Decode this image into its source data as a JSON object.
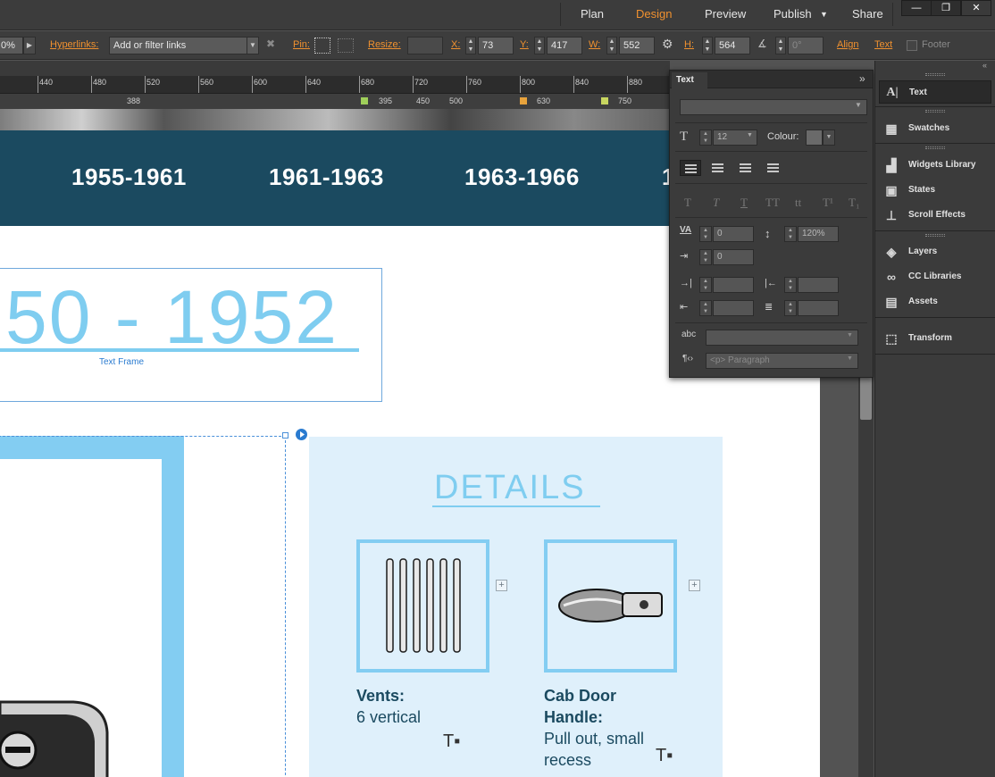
{
  "topbar": {
    "modes": [
      "Plan",
      "Design",
      "Preview",
      "Publish",
      "Share"
    ],
    "active_mode": "Design",
    "publish_arrow": "▼",
    "window_buttons": [
      "—",
      "❐",
      "✕"
    ]
  },
  "control_bar": {
    "zoom_value": "0%",
    "hyperlinks_label": "Hyperlinks:",
    "hyperlinks_placeholder": "Add or filter links",
    "pin_label": "Pin:",
    "resize_label": "Resize:",
    "x_label": "X:",
    "x_value": "73",
    "y_label": "Y:",
    "y_value": "417",
    "w_label": "W:",
    "w_value": "552",
    "h_label": "H:",
    "h_value": "564",
    "rotation_value": "0°",
    "align_label": "Align",
    "text_label": "Text",
    "footer_label": "Footer"
  },
  "ruler": {
    "ticks": [
      "440",
      "480",
      "520",
      "560",
      "600",
      "640",
      "680",
      "720",
      "760",
      "800",
      "840",
      "880"
    ],
    "sub_values": [
      "388",
      "395",
      "450",
      "500",
      "630",
      "750"
    ]
  },
  "page": {
    "nav_items": [
      "1955-1961",
      "1961-1963",
      "1963-1966",
      "1"
    ],
    "big_year": "50 - 1952",
    "text_frame_label": "Text Frame",
    "details_title": "DETAILS",
    "details": [
      {
        "label": "Vents:",
        "value": "6 vertical"
      },
      {
        "label_line1": "Cab Door",
        "label_line2": "Handle:",
        "value_line1": "Pull out, small",
        "value_line2": "recess"
      }
    ]
  },
  "text_panel": {
    "tab": "Text",
    "collapse": "»",
    "font_size": "12",
    "colour_label": "Colour:",
    "tracking": "0",
    "leading": "120%",
    "indent": "0",
    "paragraph_style": "<p> Paragraph",
    "text_style_buttons": [
      "T",
      "T",
      "T",
      "TT",
      "tt",
      "T¹",
      "T₁"
    ]
  },
  "dock": {
    "items": [
      "Text",
      "Swatches",
      "Widgets Library",
      "States",
      "Scroll Effects",
      "Layers",
      "CC Libraries",
      "Assets",
      "Transform"
    ]
  },
  "colors": {
    "accent_orange": "#f0912f",
    "nav_blue": "#1b4a60",
    "light_blue": "#7fcdf0",
    "details_bg": "#dff0fb"
  }
}
